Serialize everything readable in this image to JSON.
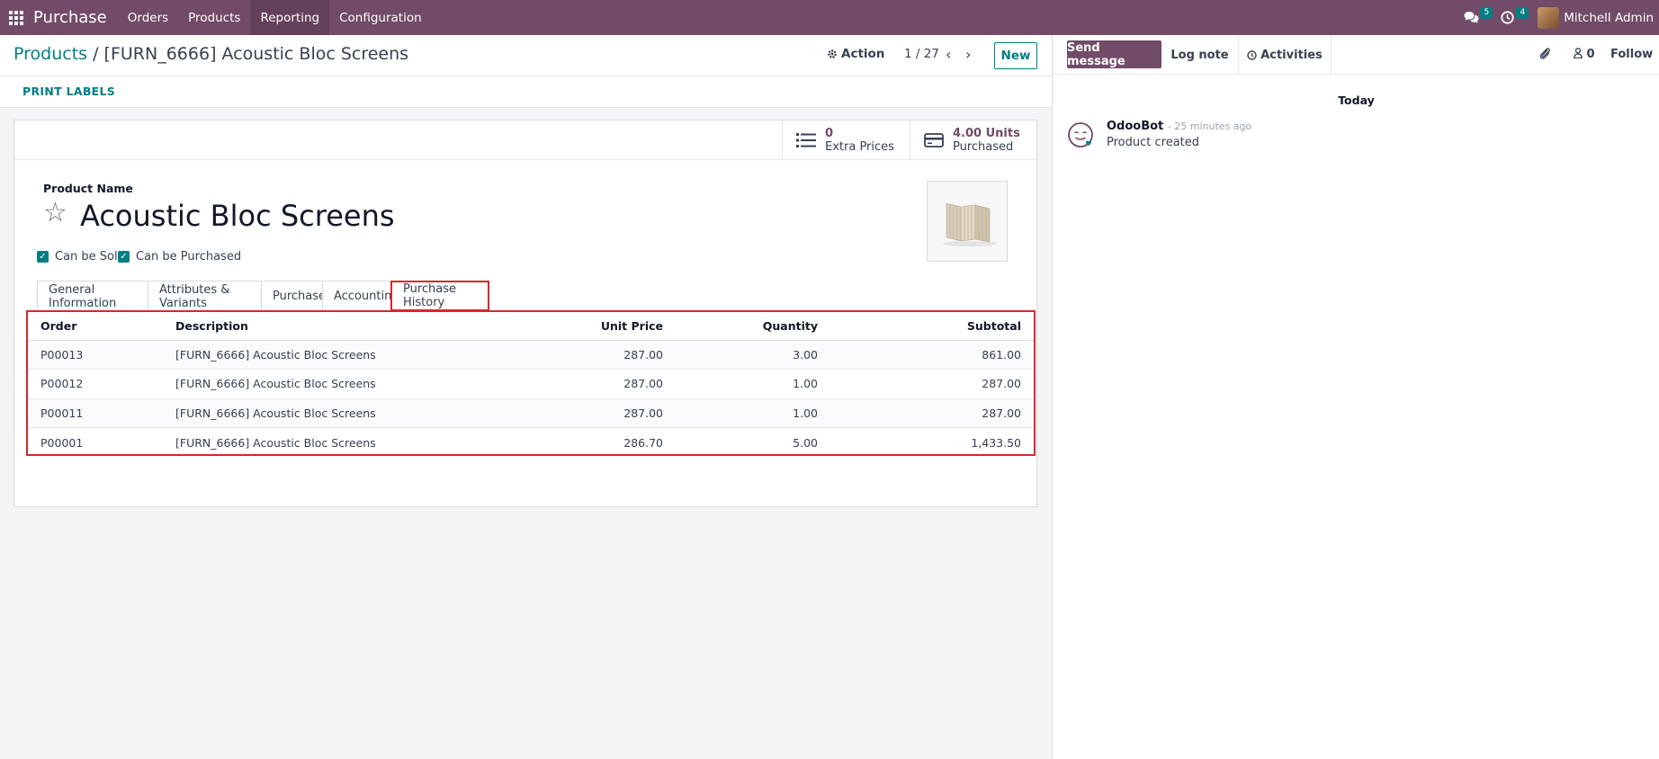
{
  "navbar": {
    "app_name": "Purchase",
    "menu": [
      "Orders",
      "Products",
      "Reporting",
      "Configuration"
    ],
    "active_menu": "Reporting",
    "messages_count": "5",
    "activities_count": "4",
    "user_name": "Mitchell Admin"
  },
  "control": {
    "breadcrumb_parent": "Products",
    "breadcrumb_separator": "/",
    "breadcrumb_current": "[FURN_6666] Acoustic Bloc Screens",
    "action_label": "Action",
    "pager": "1 / 27",
    "new_label": "New"
  },
  "statusbar": {
    "print_labels": "PRINT LABELS"
  },
  "stats": {
    "extra_prices_value": "0",
    "extra_prices_label": "Extra Prices",
    "purchased_value": "4.00 Units",
    "purchased_label": "Purchased"
  },
  "form": {
    "field_label": "Product Name",
    "product_name": "Acoustic Bloc Screens",
    "can_be_sold": "Can be Sold",
    "can_be_purchased": "Can be Purchased"
  },
  "tabs": [
    "General Information",
    "Attributes & Variants",
    "Purchase",
    "Accounting",
    "Purchase History"
  ],
  "active_tab": "Purchase History",
  "table": {
    "headers": {
      "order": "Order",
      "description": "Description",
      "unit_price": "Unit Price",
      "quantity": "Quantity",
      "subtotal": "Subtotal"
    },
    "rows": [
      {
        "order": "P00013",
        "description": "[FURN_6666] Acoustic Bloc Screens",
        "unit_price": "287.00",
        "quantity": "3.00",
        "subtotal": "861.00"
      },
      {
        "order": "P00012",
        "description": "[FURN_6666] Acoustic Bloc Screens",
        "unit_price": "287.00",
        "quantity": "1.00",
        "subtotal": "287.00"
      },
      {
        "order": "P00011",
        "description": "[FURN_6666] Acoustic Bloc Screens",
        "unit_price": "287.00",
        "quantity": "1.00",
        "subtotal": "287.00"
      },
      {
        "order": "P00001",
        "description": "[FURN_6666] Acoustic Bloc Screens",
        "unit_price": "286.70",
        "quantity": "5.00",
        "subtotal": "1,433.50"
      }
    ]
  },
  "chatter": {
    "send_message": "Send message",
    "log_note": "Log note",
    "activities": "Activities",
    "followers_count": "0",
    "follow": "Follow",
    "date_separator": "Today",
    "message_author": "OdooBot",
    "message_time": "- 25 minutes ago",
    "message_body": "Product created"
  },
  "colors": {
    "brand": "#714b67",
    "accent": "#017e84",
    "highlight": "#d9262d"
  }
}
